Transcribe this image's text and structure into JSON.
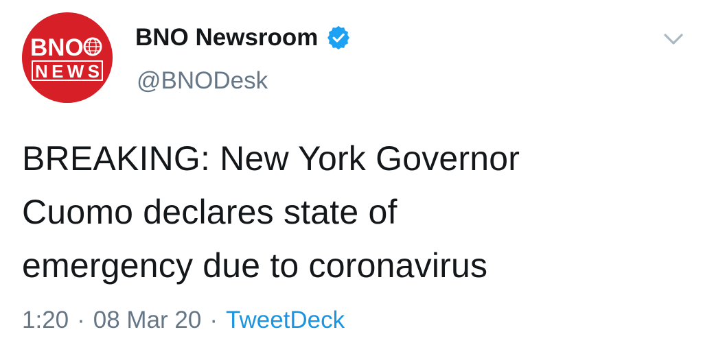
{
  "account": {
    "display_name": "BNO Newsroom",
    "handle": "@BNODesk",
    "verified": true,
    "avatar": {
      "line1": "BNO",
      "line2": "NEWS",
      "color": "#d61f26"
    }
  },
  "tweet": {
    "lines": [
      "BREAKING: New York Governor",
      "Cuomo declares state of",
      "emergency due to coronavirus"
    ]
  },
  "meta": {
    "time": "1:20",
    "separator": "·",
    "date": "08 Mar 20",
    "source": "TweetDeck"
  },
  "colors": {
    "text": "#14171a",
    "secondary": "#657786",
    "link": "#1b95e0",
    "verified": "#1da1f2"
  },
  "icons": {
    "verified": "verified-badge-icon",
    "caret": "chevron-down-icon"
  }
}
